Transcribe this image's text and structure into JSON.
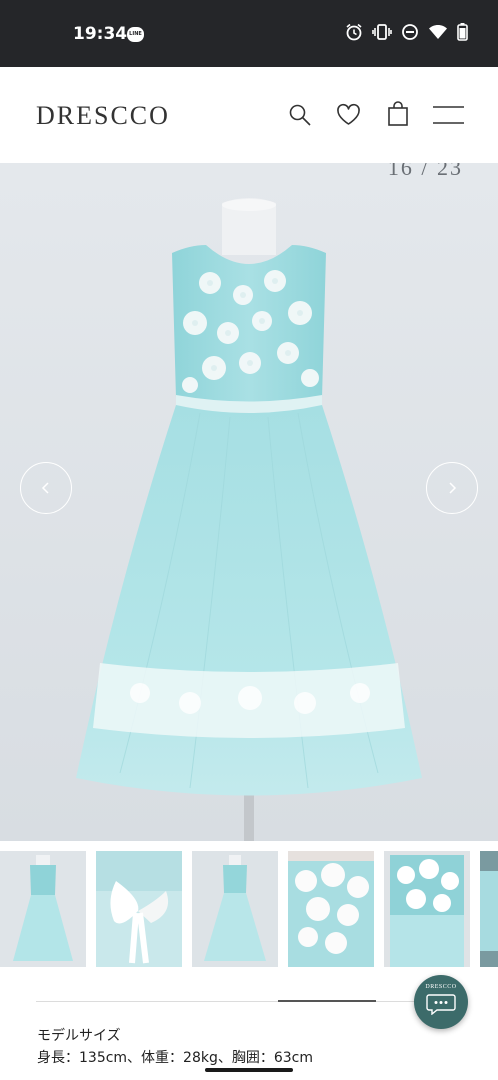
{
  "status_bar": {
    "time": "19:34",
    "line_badge": "LINE",
    "icons": [
      "alarm-icon",
      "vibrate-icon",
      "do-not-disturb-icon",
      "wifi-icon",
      "battery-icon"
    ]
  },
  "header": {
    "logo": "DRESCCO",
    "icons": [
      "search-icon",
      "heart-icon",
      "shopping-bag-icon",
      "menu-icon"
    ]
  },
  "gallery": {
    "counter": "16 / 23",
    "prev_icon": "chevron-left-icon",
    "next_icon": "chevron-right-icon",
    "thumbnail_count_visible": 6
  },
  "model_info": {
    "title": "モデルサイズ",
    "detail": "身長：135cm、体重：28kg、胸囲：63cm"
  },
  "chat": {
    "logo": "DRESCCO",
    "icon": "chat-bubble-icon"
  },
  "colors": {
    "status_bar_bg": "#252629",
    "dress_mint": "#aee3e6",
    "image_bg": "#e2e6ea",
    "chat_bg": "#3c6b6a"
  }
}
